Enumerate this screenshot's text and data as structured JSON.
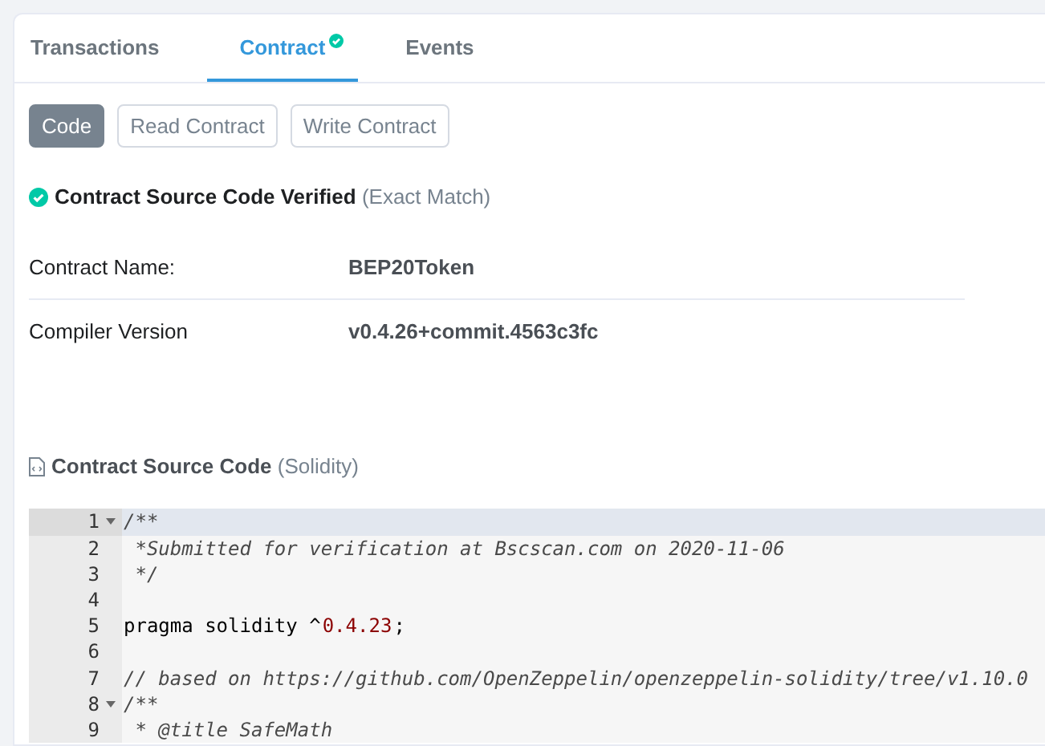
{
  "tabs": [
    {
      "label": "Transactions",
      "selected": false,
      "verified": false
    },
    {
      "label": "Contract",
      "selected": true,
      "verified": true
    },
    {
      "label": "Events",
      "selected": false,
      "verified": false
    }
  ],
  "code_buttons": [
    {
      "label": "Code",
      "selected": true
    },
    {
      "label": "Read Contract",
      "selected": false
    },
    {
      "label": "Write Contract",
      "selected": false
    }
  ],
  "verification": {
    "title": "Contract Source Code Verified",
    "note": "(Exact Match)"
  },
  "details": [
    {
      "label": "Contract Name:",
      "value": "BEP20Token"
    },
    {
      "label": "Compiler Version",
      "value": "v0.4.26+commit.4563c3fc"
    }
  ],
  "source": {
    "title": "Contract Source Code",
    "note": "(Solidity)",
    "lines": [
      {
        "number": "1",
        "foldable": true,
        "active": true,
        "tokens": [
          {
            "kind": "comment",
            "text": "/**"
          }
        ]
      },
      {
        "number": "2",
        "foldable": false,
        "active": false,
        "tokens": [
          {
            "kind": "comment",
            "text": " *Submitted for verification at Bscscan.com on 2020-11-06"
          }
        ]
      },
      {
        "number": "3",
        "foldable": false,
        "active": false,
        "tokens": [
          {
            "kind": "comment",
            "text": " */"
          }
        ]
      },
      {
        "number": "4",
        "foldable": false,
        "active": false
      },
      {
        "number": "5",
        "foldable": false,
        "active": false,
        "tokens": [
          {
            "kind": "plain",
            "text": "pragma solidity ^"
          },
          {
            "kind": "number",
            "text": "0.4.23"
          },
          {
            "kind": "plain",
            "text": ";"
          }
        ]
      },
      {
        "number": "6",
        "foldable": false,
        "active": false
      },
      {
        "number": "7",
        "foldable": false,
        "active": false,
        "tokens": [
          {
            "kind": "comment",
            "text": "// based on https://github.com/OpenZeppelin/openzeppelin-solidity/tree/v1.10.0"
          }
        ]
      },
      {
        "number": "8",
        "foldable": true,
        "active": false,
        "tokens": [
          {
            "kind": "comment",
            "text": "/**"
          }
        ]
      },
      {
        "number": "9",
        "foldable": false,
        "active": false,
        "tokens": [
          {
            "kind": "comment",
            "text": " * @title SafeMath"
          }
        ]
      }
    ]
  }
}
